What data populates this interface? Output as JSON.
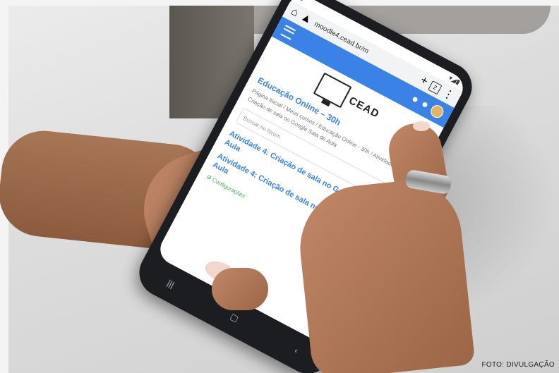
{
  "phone": {
    "url": "moodle4.cead.br/m",
    "logo_text": "CEAD",
    "course_title": "Educação Online – 30h",
    "breadcrumb": "Página Inicial / Meus cursos / Educação Online - 30h / Atividade 4: Criação de sala no Google Sala de Aula",
    "search_placeholder": "Buscar no fórum",
    "activity_title_1": "Atividade 4: Criação de sala no Google Sala de Aula",
    "activity_title_2": "Atividade 4: Criação de sala no Google Sala de Aula",
    "settings_label": "Configurações"
  },
  "credit": "FOTO: DIVULGAÇÃO"
}
